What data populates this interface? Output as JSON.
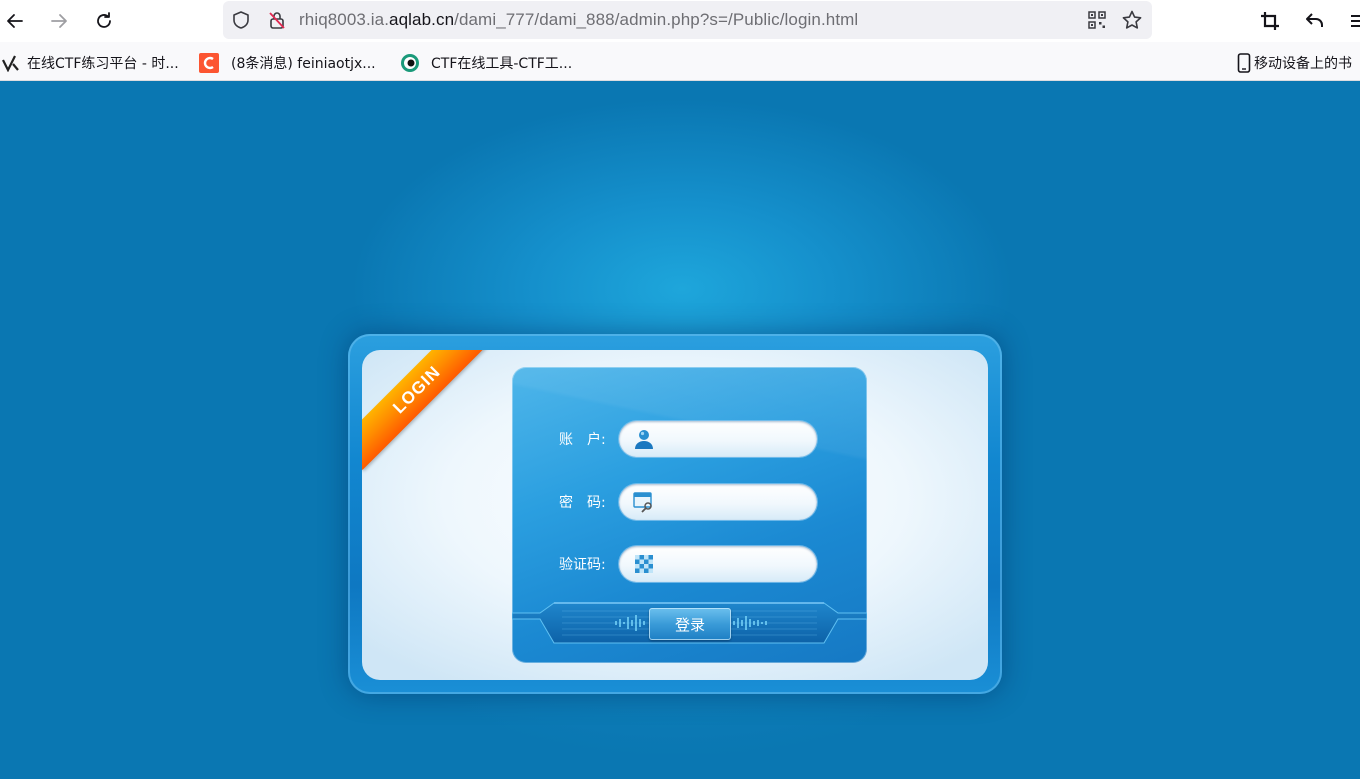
{
  "browser": {
    "url_prefix": "rhiq8003.ia.",
    "url_host": "aqlab.cn",
    "url_path": "/dami_777/dami_888/admin.php?s=/Public/login.html",
    "bookmarks": [
      {
        "label": "在线CTF练习平台 - 时..."
      },
      {
        "label": "(8条消息) feiniaotjx..."
      },
      {
        "label": "CTF在线工具-CTF工..."
      }
    ],
    "mobile_bookmarks_label": "移动设备上的书"
  },
  "login": {
    "ribbon_text": "LOGIN",
    "account_label": "账　户:",
    "password_label": "密　码:",
    "captcha_label": "验证码:",
    "account_value": "",
    "password_value": "",
    "captcha_value": "",
    "submit_label": "登录"
  },
  "colors": {
    "page_bg": "#0a77b2",
    "ribbon": "#ff8a00",
    "card": "#2b9fe0"
  }
}
